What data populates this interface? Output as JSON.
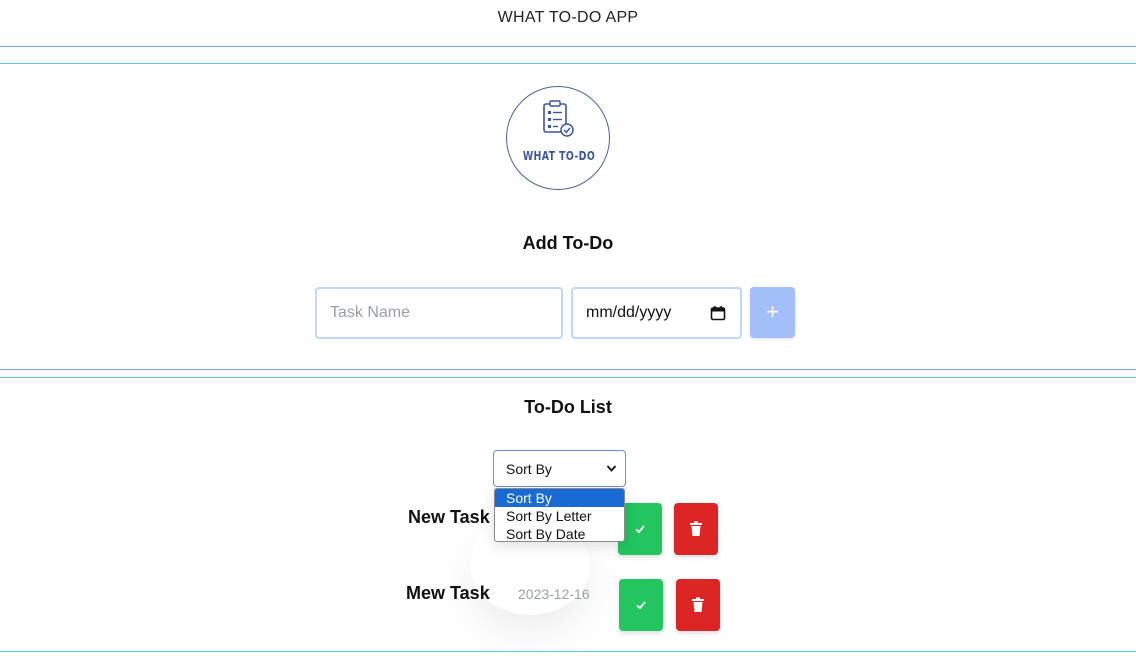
{
  "app_title": "WHAT TO-DO APP",
  "logo": {
    "text": "WHAT TO-DO"
  },
  "add_section": {
    "title": "Add To-Do",
    "task_input": {
      "placeholder": "Task Name",
      "value": ""
    },
    "date_input": {
      "value": "mm/dd/yyyy"
    },
    "add_button_label": "+"
  },
  "list_section": {
    "title": "To-Do List",
    "sort": {
      "selected": "Sort By",
      "options": [
        "Sort By",
        "Sort By Letter",
        "Sort By Date"
      ]
    },
    "tasks": [
      {
        "name": "New Task",
        "date": ""
      },
      {
        "name": "Mew Task",
        "date": "2023-12-16"
      }
    ]
  },
  "colors": {
    "accent": "#a3bffa",
    "done": "#22c55e",
    "delete": "#dc2626",
    "logo": "#4a63a8"
  }
}
